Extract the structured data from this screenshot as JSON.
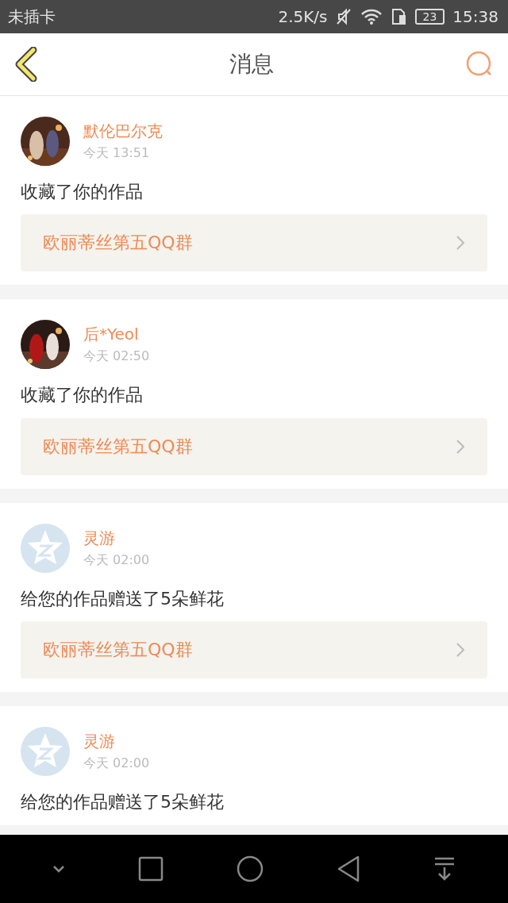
{
  "status_bar": {
    "carrier": "未插卡",
    "speed": "2.5K/s",
    "battery": "23",
    "time": "15:38"
  },
  "header": {
    "title": "消息"
  },
  "messages": [
    {
      "name": "默伦巴尔克",
      "time": "今天 13:51",
      "text": "收藏了你的作品",
      "link": "欧丽蒂丝第五QQ群"
    },
    {
      "name": "后*Yeol",
      "time": "今天 02:50",
      "text": "收藏了你的作品",
      "link": "欧丽蒂丝第五QQ群"
    },
    {
      "avatar": {
        "kind": "default"
      },
      "name": "灵游",
      "time": "今天 02:00",
      "text": "给您的作品赠送了5朵鲜花",
      "link": "欧丽蒂丝第五QQ群"
    },
    {
      "avatar": {
        "kind": "default"
      },
      "name": "灵游",
      "time": "今天 02:00",
      "text": "给您的作品赠送了5朵鲜花"
    }
  ]
}
